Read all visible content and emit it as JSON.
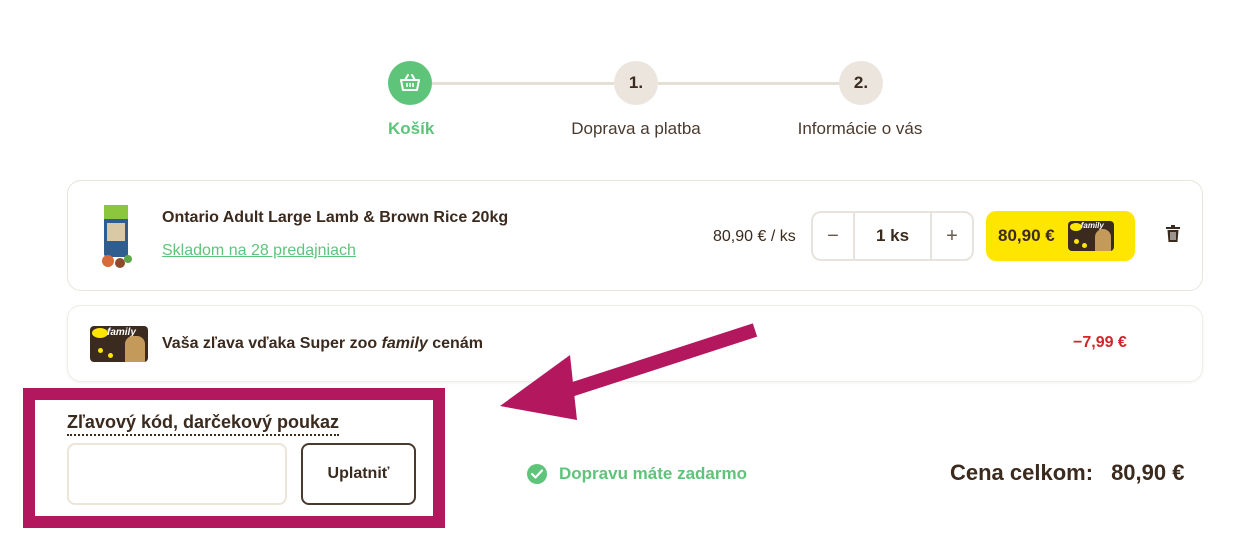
{
  "stepper": {
    "steps": [
      {
        "marker": "",
        "label": "Košík",
        "active": true
      },
      {
        "marker": "1.",
        "label": "Doprava a platba",
        "active": false
      },
      {
        "marker": "2.",
        "label": "Informácie o vás",
        "active": false
      }
    ]
  },
  "cart": {
    "item": {
      "name": "Ontario Adult Large Lamb & Brown Rice 20kg",
      "stock": "Skladom na 28 predajniach",
      "unit_price": "80,90 € / ks",
      "quantity": "1 ks",
      "minus": "−",
      "plus": "+",
      "price": "80,90 €"
    },
    "discount": {
      "text_before": "Vaša zľava vďaka Super zoo ",
      "text_italic": "family",
      "text_after": " cenám",
      "amount": "−7,99 €"
    }
  },
  "coupon": {
    "label": "Zľavový kód, darčekový poukaz",
    "placeholder": "",
    "value": "",
    "apply_label": "Uplatniť"
  },
  "shipping": {
    "free_text": "Dopravu máte zadarmo"
  },
  "summary": {
    "total_label": "Cena celkom:",
    "total_value": "80,90 €"
  },
  "colors": {
    "accent_green": "#5ec47a",
    "price_yellow": "#ffe600",
    "discount_red": "#d3242c",
    "highlight": "#b3185f"
  }
}
